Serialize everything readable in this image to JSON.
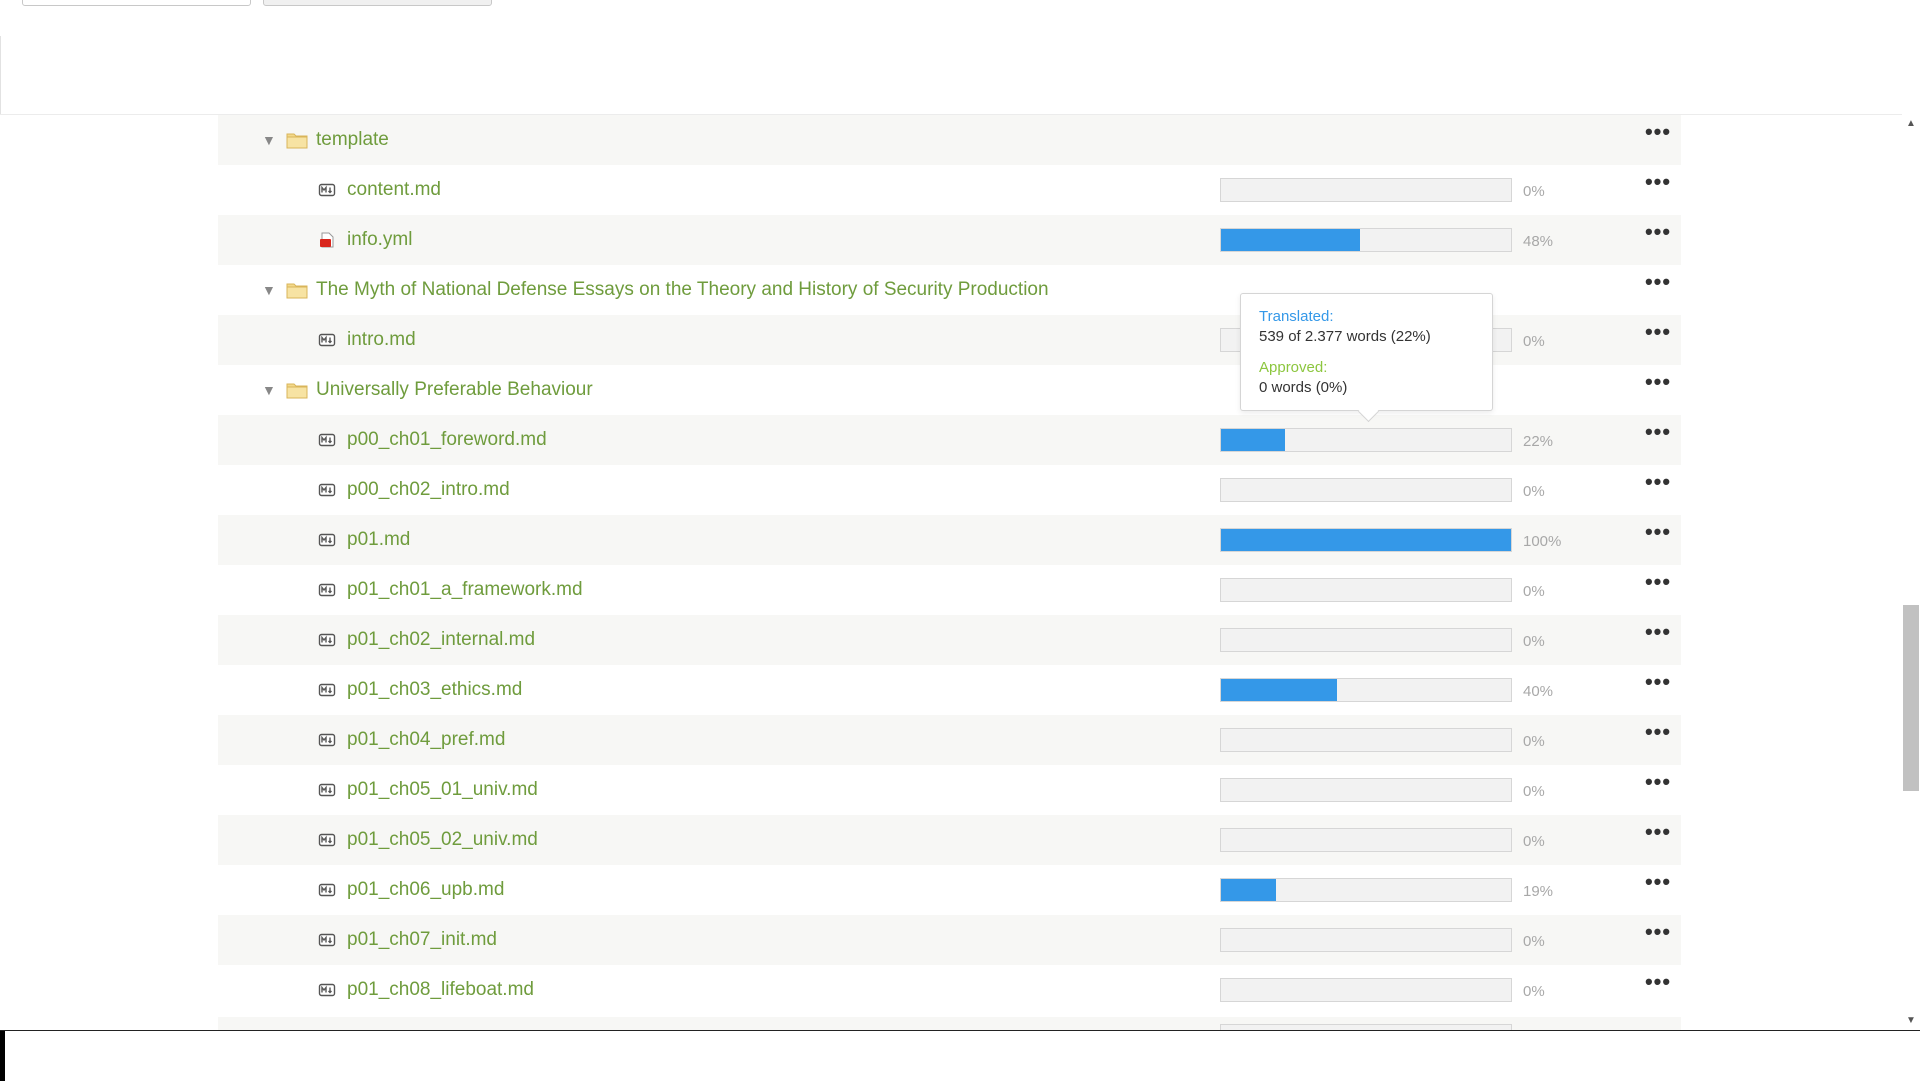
{
  "tree": {
    "rows": [
      {
        "kind": "folder",
        "label": "template",
        "shade": true
      },
      {
        "kind": "file",
        "icon": "md",
        "label": "content.md",
        "progress": 0,
        "pct": "0%",
        "shade": false
      },
      {
        "kind": "file",
        "icon": "yml",
        "label": "info.yml",
        "progress": 48,
        "pct": "48%",
        "shade": true
      },
      {
        "kind": "folder",
        "label": "The Myth of National Defense Essays on the Theory and History of Security Production",
        "shade": false
      },
      {
        "kind": "file",
        "icon": "md",
        "label": "intro.md",
        "progress": 0,
        "pct": "0%",
        "shade": true
      },
      {
        "kind": "folder",
        "label": "Universally Preferable Behaviour",
        "shade": false
      },
      {
        "kind": "file",
        "icon": "md",
        "label": "p00_ch01_foreword.md",
        "progress": 22,
        "pct": "22%",
        "shade": true
      },
      {
        "kind": "file",
        "icon": "md",
        "label": "p00_ch02_intro.md",
        "progress": 0,
        "pct": "0%",
        "shade": false
      },
      {
        "kind": "file",
        "icon": "md",
        "label": "p01.md",
        "progress": 100,
        "pct": "100%",
        "shade": true
      },
      {
        "kind": "file",
        "icon": "md",
        "label": "p01_ch01_a_framework.md",
        "progress": 0,
        "pct": "0%",
        "shade": false
      },
      {
        "kind": "file",
        "icon": "md",
        "label": "p01_ch02_internal.md",
        "progress": 0,
        "pct": "0%",
        "shade": true
      },
      {
        "kind": "file",
        "icon": "md",
        "label": "p01_ch03_ethics.md",
        "progress": 40,
        "pct": "40%",
        "shade": false
      },
      {
        "kind": "file",
        "icon": "md",
        "label": "p01_ch04_pref.md",
        "progress": 0,
        "pct": "0%",
        "shade": true
      },
      {
        "kind": "file",
        "icon": "md",
        "label": "p01_ch05_01_univ.md",
        "progress": 0,
        "pct": "0%",
        "shade": false
      },
      {
        "kind": "file",
        "icon": "md",
        "label": "p01_ch05_02_univ.md",
        "progress": 0,
        "pct": "0%",
        "shade": true
      },
      {
        "kind": "file",
        "icon": "md",
        "label": "p01_ch06_upb.md",
        "progress": 19,
        "pct": "19%",
        "shade": false
      },
      {
        "kind": "file",
        "icon": "md",
        "label": "p01_ch07_init.md",
        "progress": 0,
        "pct": "0%",
        "shade": true
      },
      {
        "kind": "file",
        "icon": "md",
        "label": "p01_ch08_lifeboat.md",
        "progress": 0,
        "pct": "0%",
        "shade": false
      }
    ]
  },
  "tooltip": {
    "translated_label": "Translated:",
    "translated_value": "539 of 2.377 words (22%)",
    "approved_label": "Approved:",
    "approved_value": "0 words (0%)"
  },
  "colors": {
    "label": "#6f9c3d",
    "progress_fill": "#3498e8",
    "translated": "#3498e8",
    "approved": "#8cc63e"
  },
  "icons": {
    "toggle": "triangle-down-icon",
    "folder": "folder-icon",
    "md": "markdown-file-icon",
    "yml": "yaml-file-icon",
    "more": "more-dots-icon"
  }
}
